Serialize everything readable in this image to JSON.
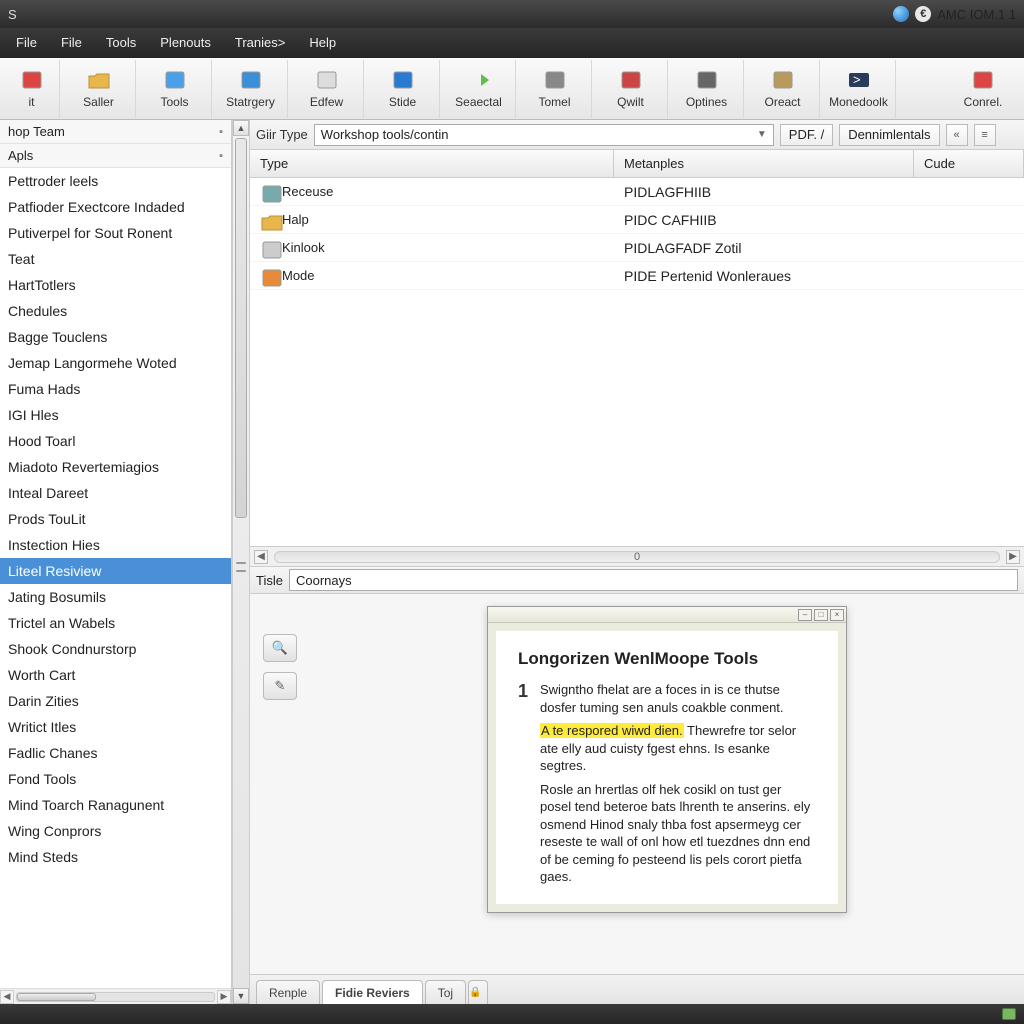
{
  "titlebar": {
    "app_letter": "S",
    "right_text": "AMC IOM.1 1"
  },
  "menubar": [
    "File",
    "File",
    "Tools",
    "Plenouts",
    "Tranies>",
    "Help"
  ],
  "toolbar": [
    {
      "label": "it",
      "icon": "doc-red"
    },
    {
      "label": "Saller",
      "icon": "folder"
    },
    {
      "label": "Tools",
      "icon": "window-blue"
    },
    {
      "label": "Statrgery",
      "icon": "monitor"
    },
    {
      "label": "Edfew",
      "icon": "page"
    },
    {
      "label": "Stide",
      "icon": "app-blue"
    },
    {
      "label": "Seaectal",
      "icon": "arrow-green"
    },
    {
      "label": "Tomel",
      "icon": "wrench"
    },
    {
      "label": "Qwilt",
      "icon": "tools-x"
    },
    {
      "label": "Optines",
      "icon": "gear-search"
    },
    {
      "label": "Oreact",
      "icon": "lock"
    },
    {
      "label": "Monedoolk",
      "icon": "terminal"
    },
    {
      "label": "Conrel.",
      "icon": "cal-red"
    }
  ],
  "sidebar": {
    "head1": "hop Team",
    "head2": "Apls",
    "items": [
      "Pettroder leels",
      "Patfioder Exectcore Indaded",
      "Putiverpel for Sout Ronent",
      "Teat",
      "HartTotlers",
      "Chedules",
      "Bagge Touclens",
      "Jemap Langormehe Woted",
      "Fuma Hads",
      "IGI Hles",
      "Hood Toarl",
      "Miadoto Revertemiagios",
      "Inteal Dareet",
      "Prods TouLit",
      "Instection Hies",
      "Liteel Resiview",
      "Jating Bosumils",
      "Trictel an Wabels",
      "Shook Condnurstorp",
      "Worth Cart",
      "Darin Zities",
      "Writict Itles",
      "Fadlic Chanes",
      "Fond Tools",
      "Mind Toarch Ranagunent",
      "Wing Conprors",
      "Mind Steds"
    ],
    "selected_index": 15
  },
  "filter": {
    "label": "Giir Type",
    "placeholder": "Workshop tools/contin",
    "seg1": "PDF. /",
    "seg2": "Dennimlentals"
  },
  "columns": {
    "type": "Type",
    "meta": "Metanples",
    "code": "Cude"
  },
  "rows": [
    {
      "type": "Receuse",
      "meta": "PIDLAGFHIIB",
      "icon": "page-arrow"
    },
    {
      "type": "Halp",
      "meta": "PIDC CAFHIIB",
      "icon": "folder-yellow"
    },
    {
      "type": "Kinlook",
      "meta": "PIDLAGFADF Zotil",
      "icon": "page-plain"
    },
    {
      "type": "Mode",
      "meta": "PIDE Pertenid Wonleraues",
      "icon": "box-orange"
    }
  ],
  "hscroll_label": "0",
  "bottom_filter": {
    "label": "Tisle",
    "value": "Coornays"
  },
  "doc": {
    "title": "Longorizen WenlMoope Tools",
    "para1_a": "Swigntho fhelat are a foces in is ce thutse dosfer tuming sen anuls coakble conment.",
    "para1_hl": "A te respored wiwd dien.",
    "para1_b": "Thewrefre tor selor ate elly aud cuisty fgest ehns. Is esanke segtres.",
    "para2": "Rosle an hrertlas olf hek cosikl on tust ger posel tend beteroe bats lhrenth te anserins. ely osmend Hinod snaly thba fost apsermeyg cer reseste te wall of onl how etl tuezdnes dnn end of be ceming fo pesteend lis pels corort pietfa gaes."
  },
  "bottom_tabs": [
    "Renple",
    "Fidie Reviers",
    "Toj"
  ]
}
